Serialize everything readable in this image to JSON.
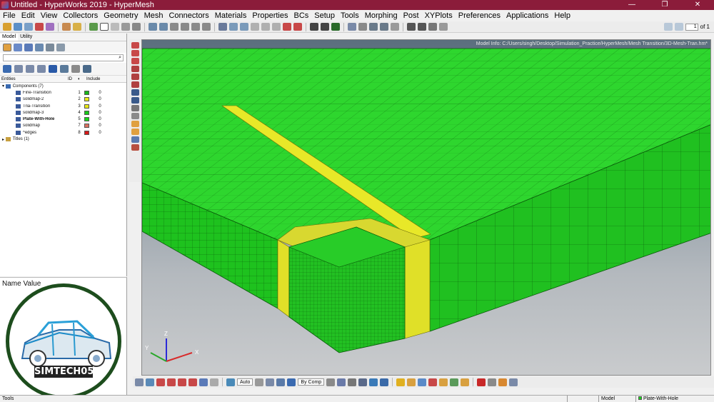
{
  "window": {
    "title": "Untitled - HyperWorks 2019 - HyperMesh",
    "controls": [
      "—",
      "❐",
      "✕"
    ]
  },
  "menu": [
    "File",
    "Edit",
    "View",
    "Collectors",
    "Geometry",
    "Mesh",
    "Connectors",
    "Materials",
    "Properties",
    "BCs",
    "Setup",
    "Tools",
    "Morphing",
    "Post",
    "XYPlots",
    "Preferences",
    "Applications",
    "Help"
  ],
  "pager": {
    "value": "1",
    "of": "of 1"
  },
  "left_panel": {
    "tabs": [
      "Model",
      "Utility"
    ],
    "columns": {
      "entities": "Entities",
      "id": "ID",
      "include": "Include"
    },
    "root": "Components (7)",
    "components": [
      {
        "name": "Fine-Transition",
        "id": "1",
        "color": "#18b818",
        "include": "0",
        "bold": false
      },
      {
        "name": "solidmap-2",
        "id": "2",
        "color": "#e8e818",
        "include": "0",
        "bold": false
      },
      {
        "name": "Tria-Transition",
        "id": "3",
        "color": "#e8e818",
        "include": "0",
        "bold": false
      },
      {
        "name": "solidmap-3",
        "id": "4",
        "color": "#18c818",
        "include": "0",
        "bold": false
      },
      {
        "name": "Plate-With-Hole",
        "id": "5",
        "color": "#18d818",
        "include": "0",
        "bold": true
      },
      {
        "name": "solidmap",
        "id": "7",
        "color": "#d87060",
        "include": "0",
        "bold": false
      },
      {
        "name": "^edges",
        "id": "8",
        "color": "#d81818",
        "include": "0",
        "bold": false
      }
    ],
    "titles": "Titles (1)"
  },
  "name_value": {
    "header": "Name Value",
    "logo_text": "SIMTECH05"
  },
  "viewport": {
    "model_info": "Model Info: C:/Users/singh/Desktop/Simulation_Practice/HyperMesh/Mesh Transition/3D-Mesh-Tran.hm*",
    "axis": {
      "x": "X",
      "y": "Y",
      "z": "Z"
    }
  },
  "bottom": {
    "auto": "Auto",
    "by_comp": "By Comp"
  },
  "status": {
    "left": "Tools",
    "model": "Model",
    "component": "Plate-With-Hole"
  },
  "colors": {
    "mesh_green": "#1ed21e",
    "mesh_yellow": "#e6e61e",
    "title_bg": "#8b1c3a"
  }
}
